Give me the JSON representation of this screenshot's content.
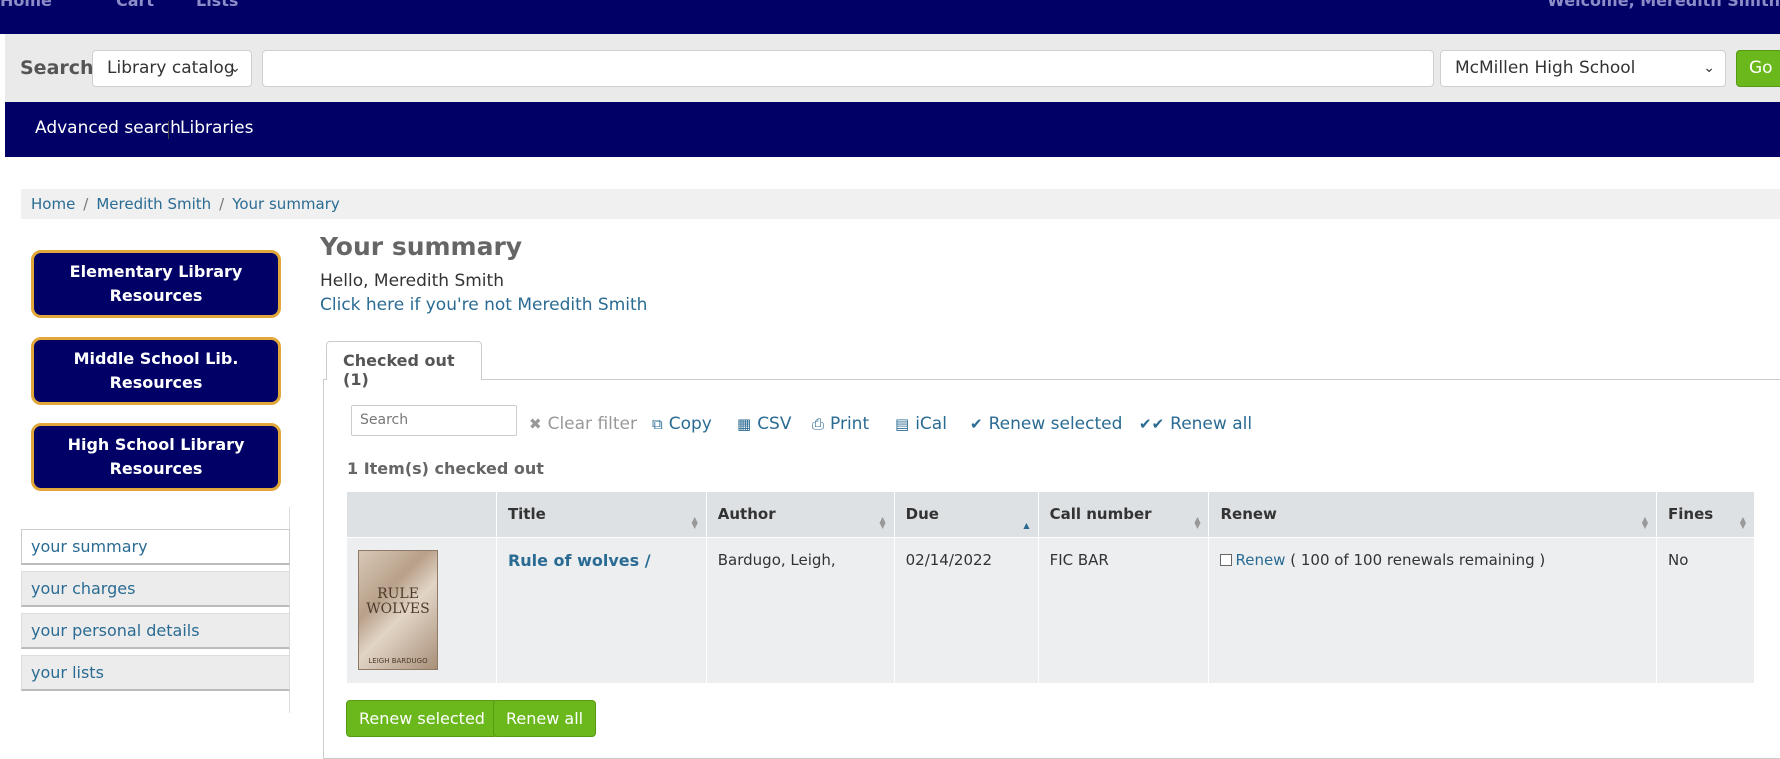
{
  "topbar": {
    "items": [
      "Home",
      "Cart",
      "Lists"
    ],
    "welcome": "Welcome, Meredith Smith"
  },
  "search": {
    "label": "Search",
    "catalog_select": "Library catalog",
    "query": "",
    "library_select": "McMillen High School",
    "go_label": "Go"
  },
  "nav": {
    "advanced_search": "Advanced search",
    "libraries": "Libraries"
  },
  "breadcrumb": [
    "Home",
    "Meredith Smith",
    "Your summary"
  ],
  "left_buttons": [
    "Elementary Library Resources",
    "Middle School Lib. Resources",
    "High School Library Resources"
  ],
  "left_menu": [
    "your summary",
    "your charges",
    "your personal details",
    "your lists"
  ],
  "main": {
    "title": "Your summary",
    "hello": "Hello, Meredith Smith",
    "not_you": "Click here if you're not Meredith Smith",
    "tab_label": "Checked out (1)",
    "table_search_placeholder": "Search",
    "tools": {
      "clear_filter": "Clear filter",
      "copy": "Copy",
      "csv": "CSV",
      "print": "Print",
      "ical": "iCal",
      "renew_selected": "Renew selected",
      "renew_all": "Renew all"
    },
    "items_count": "1 Item(s) checked out",
    "columns": [
      "",
      "Title",
      "Author",
      "Due",
      "Call number",
      "Renew",
      "Fines"
    ],
    "rows": [
      {
        "cover_title": "RULE WOLVES",
        "cover_author": "LEIGH BARDUGO",
        "title": "Rule of wolves /",
        "author": "Bardugo, Leigh,",
        "due": "02/14/2022",
        "call_number": "FIC BAR",
        "renew_link": "Renew",
        "renew_note": "( 100 of 100 renewals remaining )",
        "fines": "No"
      }
    ],
    "buttons": {
      "renew_selected": "Renew selected",
      "renew_all": "Renew all"
    }
  },
  "colors": {
    "navy": "#000066",
    "link": "#2a6b93",
    "green": "#6ab81c",
    "gold_border": "#e1a73a"
  }
}
